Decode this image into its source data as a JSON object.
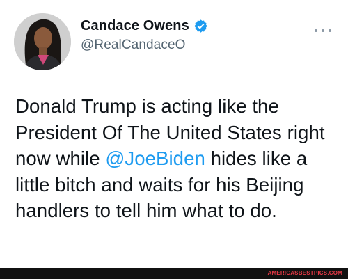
{
  "author": {
    "display_name": "Candace Owens",
    "handle": "@RealCandaceO",
    "verified": true
  },
  "tweet": {
    "text_before": "Donald Trump is acting like the President Of The United States right now while ",
    "mention": "@JoeBiden",
    "text_after": " hides like a little bitch and waits for his Beijing handlers to tell him what to do."
  },
  "icons": {
    "avatar": "profile-photo",
    "verified": "verified-badge-icon",
    "more": "more-options-icon"
  },
  "colors": {
    "name": "#0f1419",
    "handle": "#536471",
    "mention": "#1d9bf0",
    "verified": "#1d9bf0",
    "watermark": "#e63946"
  },
  "watermark": "AMERICASBESTPICS.COM"
}
